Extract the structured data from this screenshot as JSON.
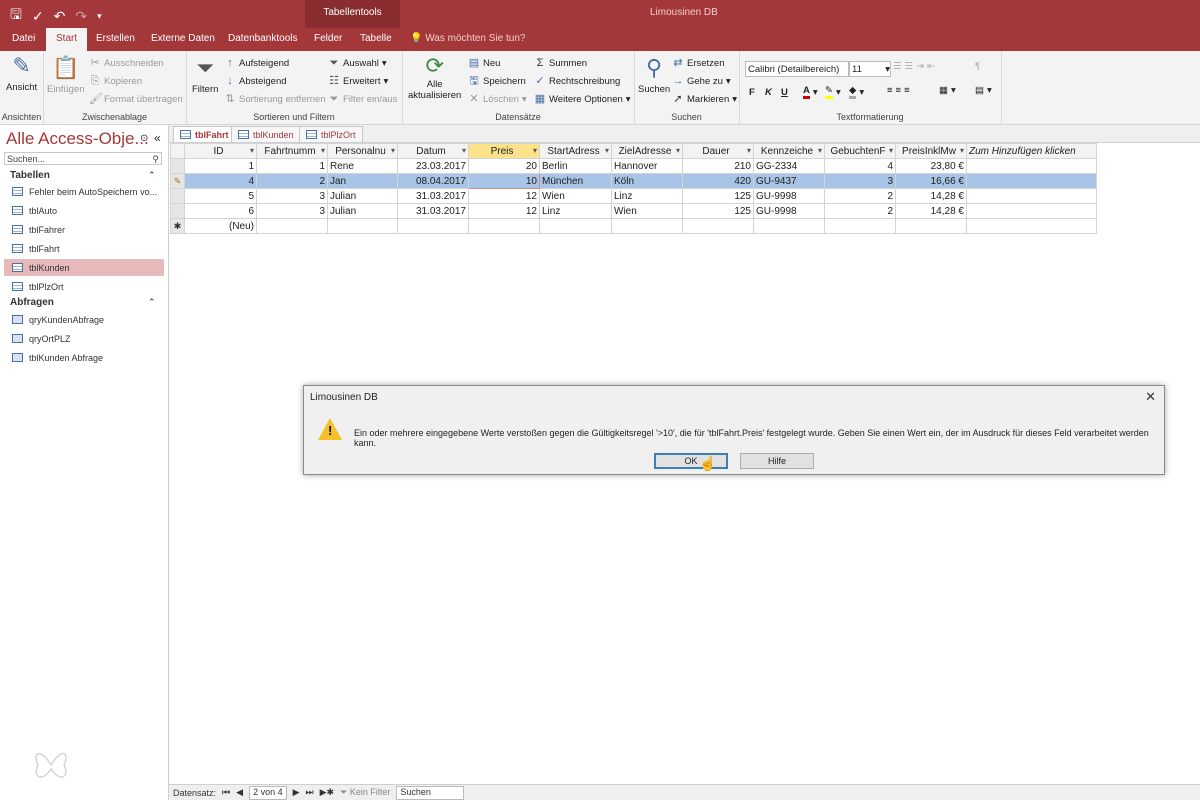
{
  "titlebar": {
    "context_tab": "Tabellentools",
    "window_title": "Limousinen DB"
  },
  "ribbon_tabs": [
    "Datei",
    "Start",
    "Erstellen",
    "Externe Daten",
    "Datenbanktools",
    "Felder",
    "Tabelle"
  ],
  "tell_me": "Was möchten Sie tun?",
  "ribbon": {
    "views": {
      "label": "Ansicht",
      "group": "Ansichten"
    },
    "clipboard": {
      "paste": "Einfügen",
      "cut": "Ausschneiden",
      "copy": "Kopieren",
      "format": "Format übertragen",
      "group": "Zwischenablage"
    },
    "sort": {
      "filter": "Filtern",
      "asc": "Aufsteigend",
      "desc": "Absteigend",
      "remove": "Sortierung entfernen",
      "selection": "Auswahl",
      "advanced": "Erweitert",
      "toggle": "Filter ein/aus",
      "group": "Sortieren und Filtern"
    },
    "records": {
      "refresh_1": "Alle",
      "refresh_2": "aktualisieren",
      "new": "Neu",
      "save": "Speichern",
      "delete": "Löschen",
      "sums": "Summen",
      "spelling": "Rechtschreibung",
      "more": "Weitere Optionen",
      "group": "Datensätze"
    },
    "find": {
      "find": "Suchen",
      "replace": "Ersetzen",
      "goto": "Gehe zu",
      "select": "Markieren",
      "group": "Suchen"
    },
    "text": {
      "font": "Calibri (Detailbereich)",
      "size": "11",
      "bold": "F",
      "italic": "K",
      "underline": "U",
      "group": "Textformatierung"
    }
  },
  "nav": {
    "title": "Alle Access-Obje...",
    "search_placeholder": "Suchen...",
    "sections": [
      {
        "label": "Tabellen",
        "items": [
          "Fehler beim AutoSpeichern vo...",
          "tblAuto",
          "tblFahrer",
          "tblFahrt",
          "tblKunden",
          "tblPlzOrt"
        ]
      },
      {
        "label": "Abfragen",
        "items": [
          "qryKundenAbfrage",
          "qryOrtPLZ",
          "tblKunden Abfrage"
        ]
      }
    ],
    "selected": "tblKunden"
  },
  "doc_tabs": [
    "tblFahrt",
    "tblKunden",
    "tblPlzOrt"
  ],
  "table": {
    "columns": [
      "ID",
      "Fahrtnumm",
      "Personalnu",
      "Datum",
      "Preis",
      "StartAdress",
      "ZielAdresse",
      "Dauer",
      "Kennzeiche",
      "GebuchtenF",
      "PreisInklMw",
      "Zum Hinzufügen klicken"
    ],
    "rows": [
      [
        "1",
        "1",
        "Rene",
        "23.03.2017",
        "20",
        "Berlin",
        "Hannover",
        "210",
        "GG-2334",
        "4",
        "23,80 €",
        ""
      ],
      [
        "4",
        "2",
        "Jan",
        "08.04.2017",
        "10",
        "München",
        "Köln",
        "420",
        "GU-9437",
        "3",
        "16,66 €",
        ""
      ],
      [
        "5",
        "3",
        "Julian",
        "31.03.2017",
        "12",
        "Wien",
        "Linz",
        "125",
        "GU-9998",
        "2",
        "14,28 €",
        ""
      ],
      [
        "6",
        "3",
        "Julian",
        "31.03.2017",
        "12",
        "Linz",
        "Wien",
        "125",
        "GU-9998",
        "2",
        "14,28 €",
        ""
      ]
    ],
    "new_row": "(Neu)"
  },
  "statusbar": {
    "label": "Datensatz:",
    "position": "2 von 4",
    "filter": "Kein Filter",
    "search": "Suchen"
  },
  "dialog": {
    "title": "Limousinen DB",
    "message": "Ein oder mehrere eingegebene Werte verstoßen gegen die Gültigkeitsregel '>10', die für 'tblFahrt.Preis' festgelegt wurde. Geben Sie einen Wert ein, der im Ausdruck für dieses Feld verarbeitet werden kann.",
    "ok": "OK",
    "help": "Hilfe"
  }
}
